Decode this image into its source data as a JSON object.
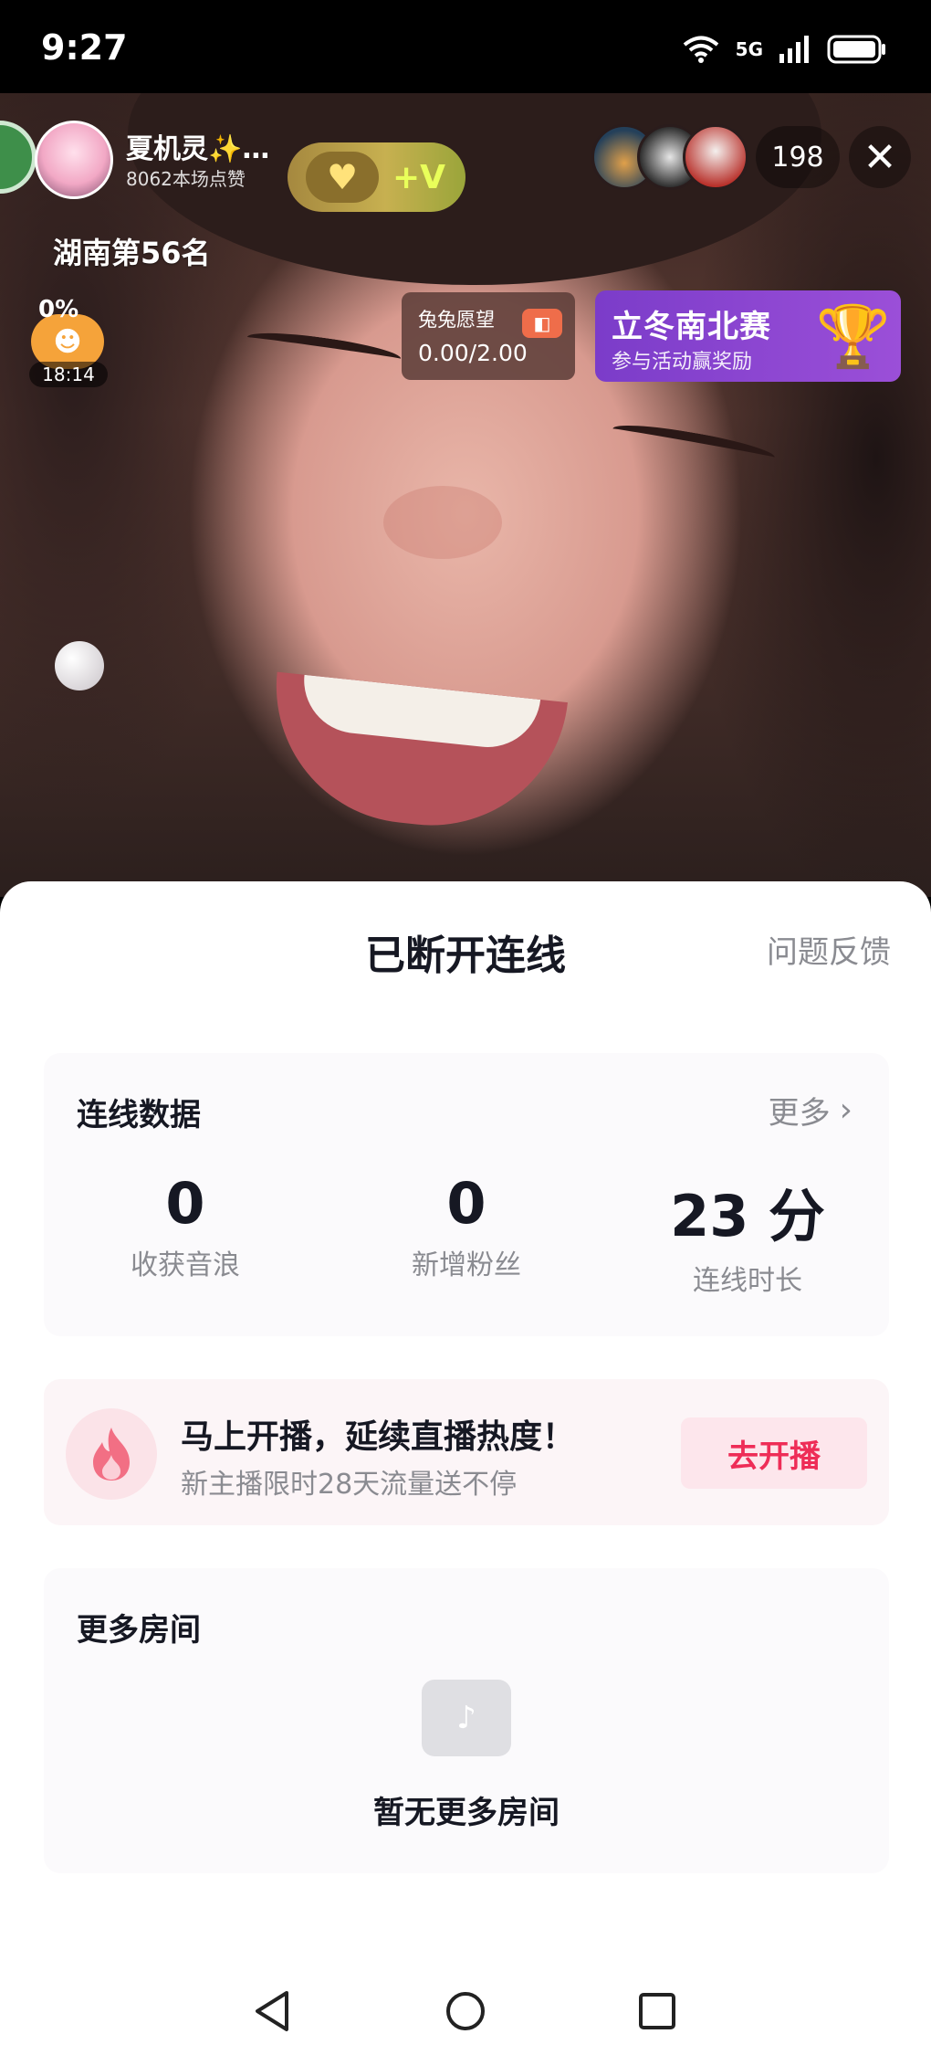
{
  "status_bar": {
    "time": "9:27",
    "network": "5G"
  },
  "live": {
    "host_name": "夏机灵✨…",
    "host_likes": "8062本场点赞",
    "viewer_count": "198",
    "rank_label": "湖南第56名",
    "timer": {
      "percent": "0%",
      "time": "18:14"
    },
    "wish": {
      "title": "兔兔愿望",
      "value": "0.00/2.00"
    },
    "event": {
      "title": "立冬南北赛",
      "subtitle": "参与活动赢奖励"
    }
  },
  "sheet": {
    "title": "已断开连线",
    "feedback": "问题反馈",
    "stats": {
      "heading": "连线数据",
      "more": "更多",
      "items": [
        {
          "value": "0",
          "label": "收获音浪"
        },
        {
          "value": "0",
          "label": "新增粉丝"
        },
        {
          "value": "23 分",
          "label": "连线时长"
        }
      ]
    },
    "promo": {
      "title": "马上开播，延续直播热度！",
      "subtitle": "新主播限时28天流量送不停",
      "button": "去开播"
    },
    "rooms": {
      "heading": "更多房间",
      "empty": "暂无更多房间"
    }
  },
  "colors": {
    "accent": "#ee2d57",
    "event_purple": "#8a45d0",
    "text_primary": "#161823",
    "text_secondary": "#8a8b91"
  }
}
